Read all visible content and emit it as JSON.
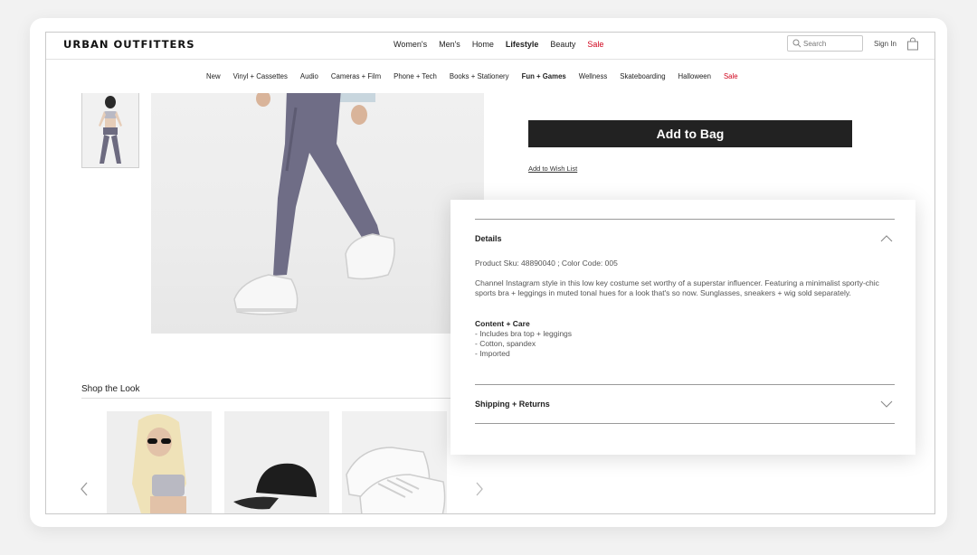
{
  "header": {
    "logo": "URBAN OUTFITTERS",
    "nav": [
      {
        "label": "Women's",
        "active": false
      },
      {
        "label": "Men's",
        "active": false
      },
      {
        "label": "Home",
        "active": false
      },
      {
        "label": "Lifestyle",
        "active": true
      },
      {
        "label": "Beauty",
        "active": false
      },
      {
        "label": "Sale",
        "active": false,
        "sale": true
      }
    ],
    "search_placeholder": "Search",
    "sign_in": "Sign In",
    "icons": [
      "search-icon",
      "shopping-bag-icon"
    ]
  },
  "subnav": [
    "New",
    "Vinyl + Cassettes",
    "Audio",
    "Cameras + Film",
    "Phone + Tech",
    "Books + Stationery",
    "Fun + Games",
    "Wellness",
    "Skateboarding",
    "Halloween",
    "Sale"
  ],
  "subnav_active": "Fun + Games",
  "product": {
    "add_to_bag": "Add to Bag",
    "wish_list": "Add to Wish List"
  },
  "shop_the_look": {
    "title": "Shop the Look"
  },
  "details_panel": {
    "details_heading": "Details",
    "sku_line": "Product Sku: 48890040 ; Color Code: 005",
    "description": "Channel Instagram style in this low key costume set worthy of a superstar influencer. Featuring a minimalist sporty-chic sports bra + leggings in muted tonal hues for a look that's so now. Sunglasses, sneakers + wig sold separately.",
    "care_heading": "Content + Care",
    "care_items": [
      "- Includes bra top + leggings",
      "- Cotton, spandex",
      "- Imported"
    ],
    "shipping_heading": "Shipping + Returns"
  },
  "colors": {
    "sale": "#d0021b",
    "button": "#222222"
  }
}
